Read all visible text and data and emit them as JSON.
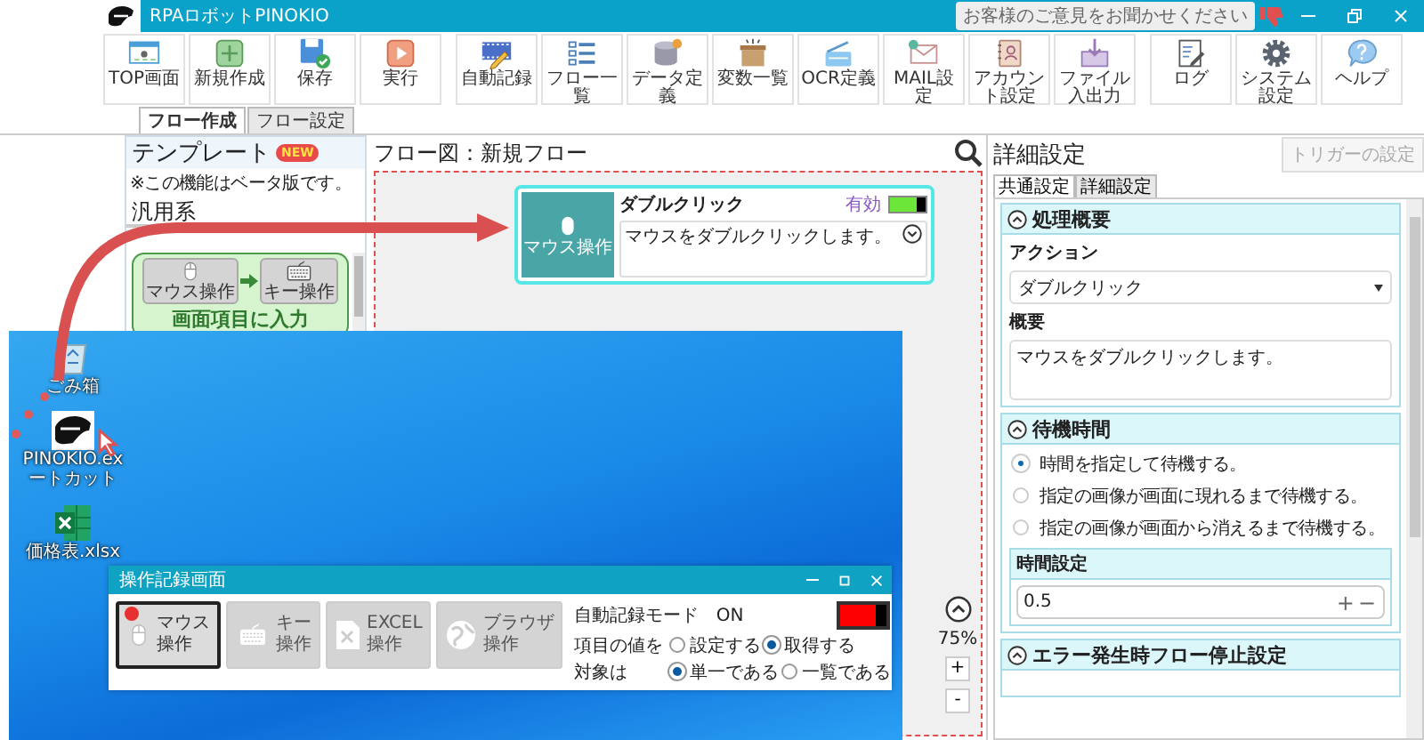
{
  "window": {
    "title": "RPAロボットPINOKIO",
    "feedback": "お客様のご意見をお聞かせください"
  },
  "toolbar_groups": [
    {
      "buttons": [
        {
          "kind": "top",
          "label": "TOP画面"
        },
        {
          "kind": "new",
          "label": "新規作成"
        },
        {
          "kind": "save",
          "label": "保存"
        },
        {
          "kind": "run",
          "label": "実行"
        }
      ]
    },
    {
      "buttons": [
        {
          "kind": "record",
          "label": "自動記録"
        },
        {
          "kind": "list",
          "label": "フロー一覧"
        },
        {
          "kind": "data",
          "label": "データ定義"
        },
        {
          "kind": "variables",
          "label": "変数一覧"
        },
        {
          "kind": "ocr",
          "label": "OCR定義"
        },
        {
          "kind": "mail",
          "label": "MAIL設定"
        },
        {
          "kind": "account",
          "label": "アカウント設定"
        },
        {
          "kind": "file",
          "label": "ファイル入出力"
        }
      ]
    },
    {
      "buttons": [
        {
          "kind": "log",
          "label": "ログ"
        },
        {
          "kind": "settings",
          "label": "システム設定"
        },
        {
          "kind": "help",
          "label": "ヘルプ"
        }
      ]
    }
  ],
  "view_tabs": [
    {
      "label": "フロー作成",
      "selected": true
    },
    {
      "label": "フロー設定",
      "selected": false
    }
  ],
  "templates": {
    "title": "テンプレート",
    "badge": "NEW",
    "note": "※この機能はベータ版です。",
    "category": "汎用系",
    "cards": [
      {
        "title": "画面項目に入力",
        "steps": [
          {
            "kind": "mouse",
            "label": "マウス操作"
          },
          {
            "kind": "keyboard",
            "label": "キー操作"
          }
        ]
      }
    ]
  },
  "flow": {
    "title": "フロー図：新規フロー",
    "zoom_level": "75%",
    "zoom_in": "+",
    "zoom_out": "-",
    "nodes": [
      {
        "kind": "mouse",
        "title": "ダブルクリック",
        "icon_label": "マウス操作",
        "status": "有効",
        "enabled": true,
        "description": "マウスをダブルクリックします。",
        "selected": true
      }
    ]
  },
  "details": {
    "title": "詳細設定",
    "trigger_button": {
      "label": "トリガーの設定",
      "disabled": true
    },
    "tabs": [
      {
        "label": "共通設定",
        "selected": true
      },
      {
        "label": "詳細設定",
        "selected": false
      }
    ],
    "sections": [
      {
        "kind": "summary",
        "title": "処理概要",
        "expanded": true,
        "action_label": "アクション",
        "action_value": "ダブルクリック",
        "summary_label": "概要",
        "summary_value": "マウスをダブルクリックします。"
      },
      {
        "kind": "wait",
        "title": "待機時間",
        "expanded": true,
        "options": [
          {
            "label": "時間を指定して待機する。",
            "selected": true
          },
          {
            "label": "指定の画像が画面に現れるまで待機する。",
            "selected": false
          },
          {
            "label": "指定の画像が画面から消えるまで待機する。",
            "selected": false
          }
        ],
        "time_label": "時間設定",
        "time_value": "0.5",
        "increment": "+",
        "decrement": "−"
      },
      {
        "kind": "stop",
        "title": "エラー発生時フロー停止設定",
        "expanded": true
      }
    ]
  },
  "desktop": {
    "icons": [
      {
        "kind": "recycle_bin",
        "label": "ごみ箱"
      },
      {
        "kind": "shortcut",
        "label": "PINOKIO.ex",
        "label_2": "ートカット",
        "pointer": true
      },
      {
        "kind": "excel",
        "label": "価格表.xlsx"
      }
    ],
    "recorder": {
      "title": "操作記録画面",
      "modes": [
        {
          "kind": "mouse",
          "title": "マウス",
          "subtitle": "操作",
          "selected": true
        },
        {
          "kind": "keyboard",
          "title": "キー",
          "subtitle": "操作",
          "selected": false
        },
        {
          "kind": "excel",
          "title": "EXCEL",
          "subtitle": "操作",
          "selected": false
        },
        {
          "kind": "browser",
          "title": "ブラウザ",
          "subtitle": "操作",
          "selected": false
        }
      ],
      "auto_mode": {
        "label": "自動記録モード",
        "value": "ON",
        "on": true
      },
      "option_rows": [
        {
          "label": "項目の値を",
          "options": [
            {
              "label": "設定する",
              "selected": false
            },
            {
              "label": "取得する",
              "selected": true
            }
          ]
        },
        {
          "label": "対象は",
          "options": [
            {
              "label": "単一である",
              "selected": true
            },
            {
              "label": "一覧である",
              "selected": false
            }
          ]
        }
      ]
    }
  }
}
